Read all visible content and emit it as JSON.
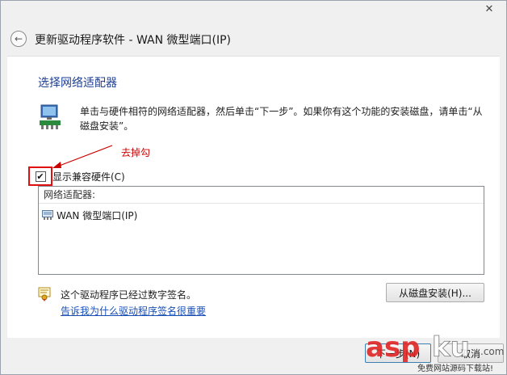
{
  "window": {
    "title": "更新驱动程序软件 - WAN 微型端口(IP)",
    "close_glyph": "✕"
  },
  "page": {
    "heading": "选择网络适配器",
    "instruction": "单击与硬件相符的网络适配器，然后单击“下一步”。如果你有这个功能的安装磁盘，请单击“从磁盘安装”。"
  },
  "annotation": {
    "text": "去掉勾",
    "color": "#cc0000"
  },
  "compatible_hardware": {
    "label": "显示兼容硬件(C)",
    "checked": true,
    "check_glyph": "✔"
  },
  "adapter_list": {
    "header": "网络适配器:",
    "items": [
      {
        "label": "WAN 微型端口(IP)",
        "icon": "network-adapter-icon"
      }
    ]
  },
  "signature": {
    "status_text": "这个驱动程序已经过数字签名。",
    "link_text": "告诉我为什么驱动程序签名很重要",
    "icon": "signed-driver-icon"
  },
  "buttons": {
    "have_disk": "从磁盘安装(H)...",
    "next": "下一步(N)",
    "cancel": "取消"
  },
  "watermark": {
    "logo_text": "aspku",
    "sub_text": "免费网站源码下载站"
  },
  "colors": {
    "heading": "#1c3f94",
    "link": "#1a4fb5",
    "highlight_box": "#e01010"
  }
}
